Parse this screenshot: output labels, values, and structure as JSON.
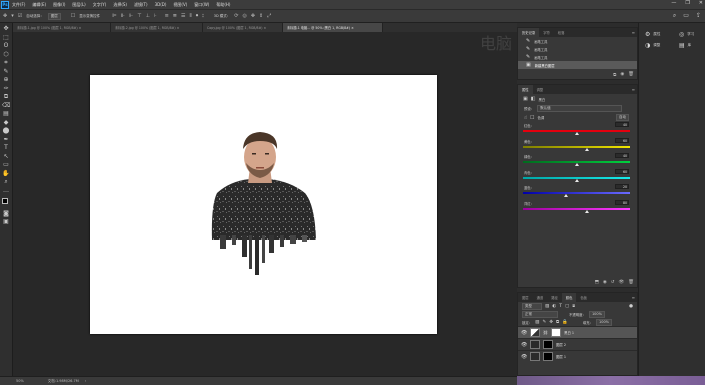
{
  "menubar": {
    "logo": "Ps",
    "items": [
      "文件(F)",
      "编辑(E)",
      "图像(I)",
      "图层(L)",
      "文字(Y)",
      "选择(S)",
      "滤镜(T)",
      "3D(D)",
      "视图(V)",
      "窗口(W)",
      "帮助(H)"
    ],
    "controls": [
      "—",
      "❐",
      "✕"
    ]
  },
  "optbar": {
    "auto_select": "自动选择：",
    "group": "图层",
    "show_transform": "显示变换控件",
    "mode_3d": "3D 模式："
  },
  "tabs": [
    {
      "label": "未标题-1.jpg @ 100% (图层 1, RGB/8#) ×",
      "active": false
    },
    {
      "label": "未标题-2.jpg @ 100% (图层 1, RGB/8#) ×",
      "active": false
    },
    {
      "label": "Copy.jpg @ 100% (图层 1, RGB/8#) ×",
      "active": false
    },
    {
      "label": "未标题-1 电脑... @ 50% (黑白 1, RGB/8#) ×",
      "active": true
    }
  ],
  "tools": [
    "✥",
    "⬚",
    "ʘ",
    "⬡",
    "⌗",
    "✎",
    "⊕",
    "✑",
    "⧉",
    "⌫",
    "▤",
    "◆",
    "⬤",
    "✒",
    "T",
    "↖",
    "▭",
    "✋",
    "⌕",
    "…"
  ],
  "status": {
    "zoom": "50%",
    "doc": "文档:1.98M/26.7M"
  },
  "history": {
    "tabs": [
      "历史记录",
      "字符",
      "段落"
    ],
    "items": [
      {
        "label": "画笔工具",
        "selected": false
      },
      {
        "label": "画笔工具",
        "selected": false
      },
      {
        "label": "画笔工具",
        "selected": false
      },
      {
        "label": "新建黑白图层",
        "selected": true
      }
    ]
  },
  "properties": {
    "tabs": [
      "属性",
      "调整"
    ],
    "title": "黑白",
    "preset_label": "预设：",
    "preset_value": "默认值",
    "tint_label": "色调",
    "auto_label": "自动",
    "sliders": [
      {
        "label": "红色：",
        "value": "40",
        "pct": 0.5,
        "colors": [
          "#e5000e",
          "#e5000e"
        ]
      },
      {
        "label": "黄色：",
        "value": "60",
        "pct": 0.6,
        "colors": [
          "#7d7d00",
          "#f2e600"
        ]
      },
      {
        "label": "绿色：",
        "value": "40",
        "pct": 0.5,
        "colors": [
          "#006b1e",
          "#00d13e"
        ]
      },
      {
        "label": "青色：",
        "value": "60",
        "pct": 0.5,
        "colors": [
          "#00a6a6",
          "#18e9e9"
        ]
      },
      {
        "label": "蓝色：",
        "value": "20",
        "pct": 0.4,
        "colors": [
          "#0000a8",
          "#6a6aff"
        ]
      },
      {
        "label": "洋红：",
        "value": "80",
        "pct": 0.6,
        "colors": [
          "#9e009e",
          "#ff3cff"
        ]
      }
    ]
  },
  "layers": {
    "tabs": [
      "图层",
      "通道",
      "路径",
      "颜色",
      "色板"
    ],
    "kind": "类型",
    "blend": "正常",
    "opacity_label": "不透明度：",
    "opacity": "100%",
    "lock_label": "锁定：",
    "fill_label": "填充：",
    "fill": "100%",
    "rows": [
      {
        "name": "黑白 1",
        "selected": true,
        "thumb": "adj"
      },
      {
        "name": "图层 2",
        "selected": false,
        "thumb": "dark"
      },
      {
        "name": "图层 1",
        "selected": false,
        "thumb": "dark"
      }
    ]
  },
  "sidecol": [
    {
      "icon": "⚙",
      "label": "属性"
    },
    {
      "icon": "◑",
      "label": "调整"
    }
  ],
  "sidecol2": [
    {
      "icon": "◎",
      "label": "学习"
    },
    {
      "icon": "▤",
      "label": "库"
    }
  ],
  "watermark": "电脑"
}
